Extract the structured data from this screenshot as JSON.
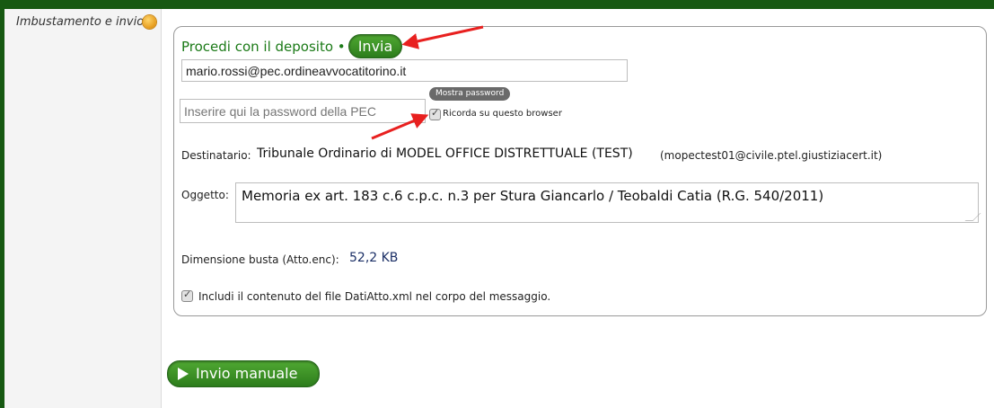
{
  "section": {
    "label": "Imbustamento e invio"
  },
  "header": {
    "title": "Procedi con il deposito •",
    "send_label": "Invia"
  },
  "form": {
    "email_value": "mario.rossi@pec.ordineavvocatitorino.it",
    "password_placeholder": "Inserire qui la password della PEC",
    "show_password_label": "Mostra password",
    "remember_label": "Ricorda su questo browser",
    "remember_checked": true
  },
  "recipient": {
    "label": "Destinatario:",
    "value": "Tribunale Ordinario di MODEL OFFICE DISTRETTUALE (TEST)",
    "email": "(mopectest01@civile.ptel.giustiziacert.it)"
  },
  "subject": {
    "label": "Oggetto:",
    "value": "Memoria ex art. 183 c.6 c.p.c. n.3 per Stura Giancarlo / Teobaldi Catia (R.G. 540/2011)"
  },
  "size": {
    "label": "Dimensione busta (Atto.enc):",
    "value": "52,2 KB"
  },
  "include": {
    "label": "Includi il contenuto del file DatiAtto.xml nel corpo del messaggio.",
    "checked": true
  },
  "manual": {
    "label": "Invio manuale"
  },
  "colors": {
    "brand_green": "#2d7d1c",
    "frame_green": "#175912",
    "arrow_red": "#e8201f"
  }
}
